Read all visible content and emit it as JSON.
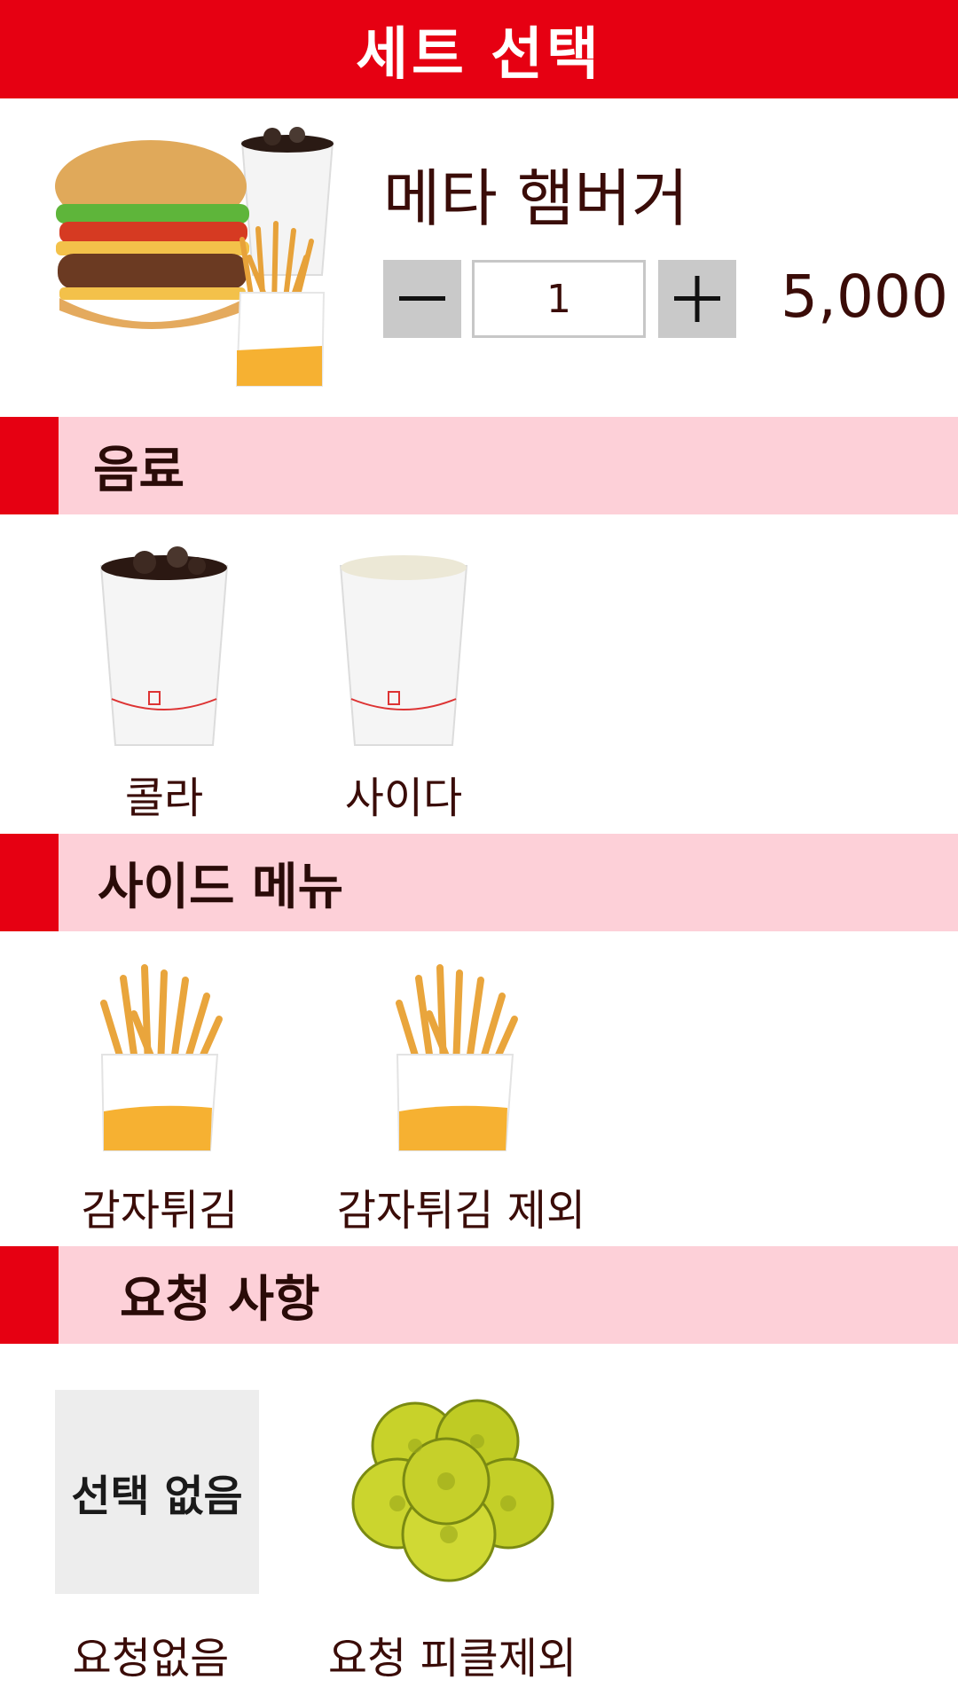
{
  "header": {
    "title": "세트 선택"
  },
  "product": {
    "name": "메타 햄버거",
    "quantity": "1",
    "price": "5,000",
    "minus_icon": "minus-icon",
    "plus_icon": "plus-icon"
  },
  "sections": {
    "drink": {
      "title": "음료",
      "items": [
        {
          "label": "콜라"
        },
        {
          "label": "사이다"
        }
      ]
    },
    "side": {
      "title": "사이드 메뉴",
      "items": [
        {
          "label": "감자튀김"
        },
        {
          "label": "감자튀김 제외"
        }
      ]
    },
    "request": {
      "title": "요청 사항",
      "none_box": "선택 없음",
      "items": [
        {
          "label": "요청없음"
        },
        {
          "label": "요청 피클제외"
        }
      ]
    }
  },
  "colors": {
    "accent": "#e60012",
    "section_bg": "#fdd0d8",
    "text": "#3a0c08",
    "stepper": "#c9c9c9"
  }
}
